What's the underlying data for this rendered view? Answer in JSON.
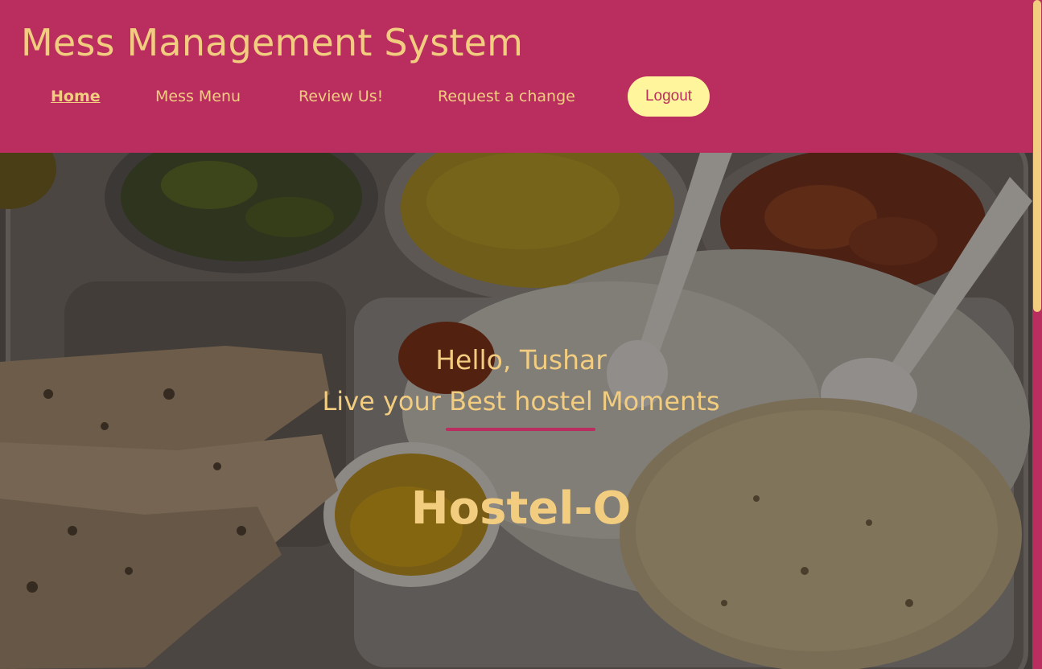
{
  "header": {
    "title": "Mess Management System"
  },
  "nav": {
    "items": [
      {
        "label": "Home",
        "active": true
      },
      {
        "label": "Mess Menu",
        "active": false
      },
      {
        "label": "Review Us!",
        "active": false
      },
      {
        "label": "Request a change",
        "active": false
      }
    ],
    "logout_label": "Logout"
  },
  "hero": {
    "greeting": "Hello, Tushar",
    "tagline": "Live your Best hostel Moments",
    "hostel_name": "Hostel-O"
  },
  "colors": {
    "primary": "#b92e5e",
    "accent_text": "#f2cd80",
    "logout_bg": "#fff59d"
  }
}
